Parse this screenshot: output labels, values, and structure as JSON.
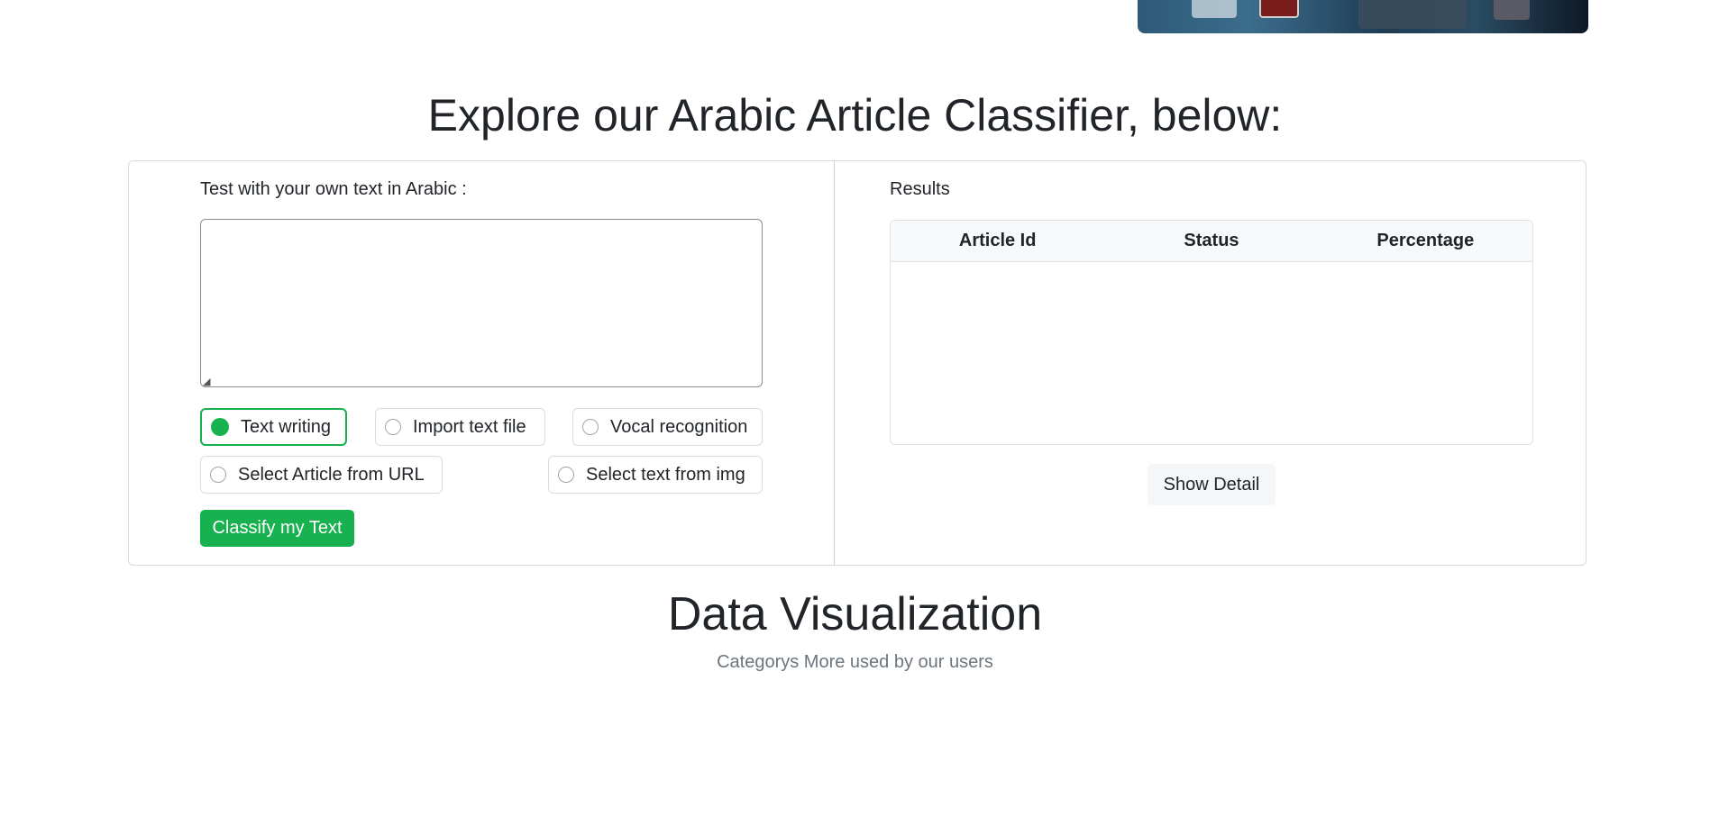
{
  "classifier": {
    "heading": "Explore our Arabic Article Classifier, below:",
    "input_label": "Test with your own text in Arabic :",
    "textarea_value": "",
    "options": [
      {
        "label": "Text writing",
        "selected": true
      },
      {
        "label": "Import text file",
        "selected": false
      },
      {
        "label": "Vocal recognition",
        "selected": false
      },
      {
        "label": "Select Article from URL",
        "selected": false
      },
      {
        "label": "Select text from img",
        "selected": false
      }
    ],
    "classify_button": "Classify my Text"
  },
  "results": {
    "label": "Results",
    "columns": [
      "Article Id",
      "Status",
      "Percentage"
    ],
    "rows": [],
    "show_detail_button": "Show Detail"
  },
  "data_visualization": {
    "title": "Data Visualization",
    "subtitle": "Categorys More used by our users"
  },
  "colors": {
    "accent": "#18b14f",
    "text": "#212529",
    "muted": "#6c757d"
  }
}
